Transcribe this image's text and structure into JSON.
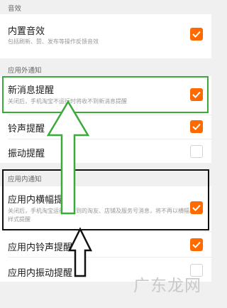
{
  "sections": {
    "sound_header": "音效",
    "outside_header": "应用外通知",
    "inside_header": "应用内通知"
  },
  "items": {
    "builtin_sound": {
      "title": "内置音效",
      "subtitle": "包括刷新、赞、发布等操作反馈音效",
      "checked": true
    },
    "new_message": {
      "title": "新消息提醒",
      "subtitle": "关闭后，手机淘宝不运行时将收不到新消息提醒",
      "checked": true
    },
    "ringtone": {
      "title": "铃声提醒",
      "checked": true
    },
    "vibrate": {
      "title": "振动提醒",
      "checked": false
    },
    "banner": {
      "title": "应用内横幅提醒",
      "subtitle": "关闭后，手机淘宝运行时收到的淘友、店铺及服务号消息，将不再以横幅样式提醒",
      "checked": true
    },
    "in_ringtone": {
      "title": "应用内铃声提醒",
      "checked": true
    },
    "in_vibrate": {
      "title": "应用内振动提醒",
      "checked": false
    }
  },
  "watermark": "广东龙网",
  "colors": {
    "accent": "#ff6a00",
    "annotation_green": "#3aaa3a",
    "annotation_black": "#111111"
  }
}
